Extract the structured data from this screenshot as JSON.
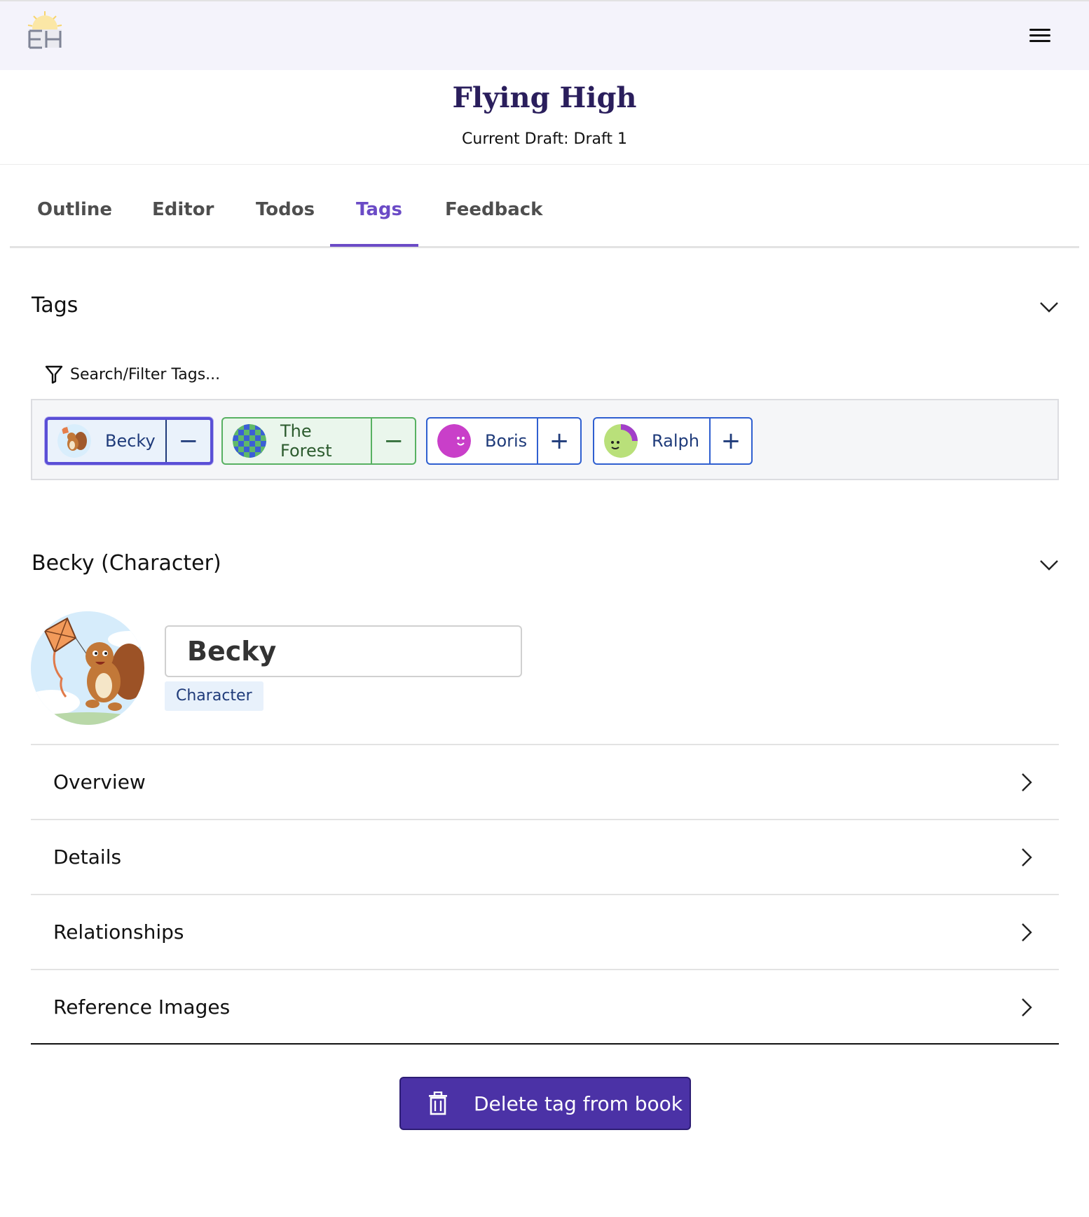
{
  "header": {
    "logo_icon": "book-sunrise-logo-icon",
    "menu_icon": "hamburger-menu-icon"
  },
  "book": {
    "title": "Flying High",
    "current_draft": "Current Draft: Draft 1"
  },
  "tabs": [
    {
      "label": "Outline",
      "active": false
    },
    {
      "label": "Editor",
      "active": false
    },
    {
      "label": "Todos",
      "active": false
    },
    {
      "label": "Tags",
      "active": true
    },
    {
      "label": "Feedback",
      "active": false
    }
  ],
  "tags_section": {
    "title": "Tags",
    "filter_placeholder": "Search/Filter Tags...",
    "chips": [
      {
        "label": "Becky",
        "action": "−",
        "state": "selected"
      },
      {
        "label": "The Forest",
        "action": "−",
        "state": "included"
      },
      {
        "label": "Boris",
        "action": "+",
        "state": "available"
      },
      {
        "label": "Ralph",
        "action": "+",
        "state": "available"
      }
    ]
  },
  "detail": {
    "header": "Becky (Character)",
    "name_value": "Becky",
    "type_badge": "Character",
    "accordions": [
      "Overview",
      "Details",
      "Relationships",
      "Reference Images"
    ]
  },
  "actions": {
    "delete_label": "Delete tag from book"
  },
  "colors": {
    "accent": "#6b4bc6",
    "title": "#2a1e5c",
    "delete_bg": "#4b32a6",
    "chip_blue": "#2f5fd0",
    "chip_green": "#58b162"
  }
}
